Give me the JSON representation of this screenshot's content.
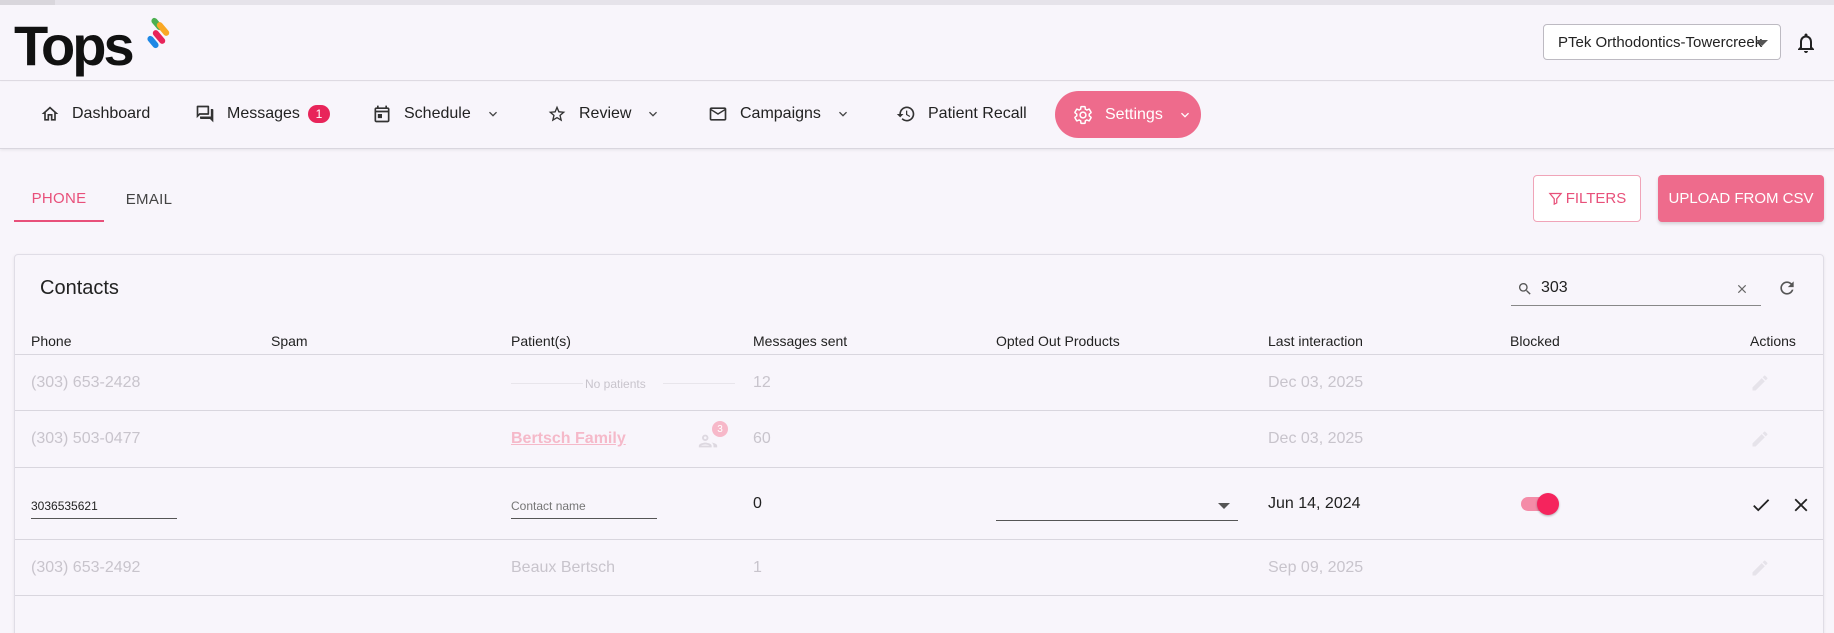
{
  "header": {
    "logo_text": "Tops",
    "org_selector": "PTek Orthodontics-Towercreek"
  },
  "nav": {
    "dashboard": "Dashboard",
    "messages": "Messages",
    "messages_badge": "1",
    "schedule": "Schedule",
    "review": "Review",
    "campaigns": "Campaigns",
    "patient_recall": "Patient Recall",
    "settings": "Settings"
  },
  "tabs": {
    "phone": "PHONE",
    "email": "EMAIL"
  },
  "actions": {
    "filters": "FILTERS",
    "upload": "UPLOAD FROM CSV"
  },
  "contacts": {
    "title": "Contacts",
    "search_value": "303",
    "columns": {
      "phone": "Phone",
      "spam": "Spam",
      "patients": "Patient(s)",
      "messages_sent": "Messages sent",
      "opted_out": "Opted Out Products",
      "last_interaction": "Last interaction",
      "blocked": "Blocked",
      "actions": "Actions"
    },
    "rows": [
      {
        "phone": "(303) 653-2428",
        "patients": "No patients",
        "messages_sent": "12",
        "last_interaction": "Dec 03, 2025"
      },
      {
        "phone": "(303) 503-0477",
        "patients": "Bertsch Family",
        "patient_count": "3",
        "messages_sent": "60",
        "last_interaction": "Dec 03, 2025"
      },
      {
        "phone": "3036535621",
        "patients_placeholder": "Contact name",
        "messages_sent": "0",
        "last_interaction": "Jun 14, 2024",
        "blocked": true
      },
      {
        "phone": "(303) 653-2492",
        "patients": "Beaux Bertsch",
        "messages_sent": "1",
        "last_interaction": "Sep 09, 2025"
      }
    ]
  },
  "colors": {
    "accent": "#ee6b8c",
    "accent_text": "#e8507a",
    "badge": "#e8245a",
    "toggle_thumb": "#f5245d"
  },
  "icons": [
    "home-icon",
    "chat-icon",
    "calendar-icon",
    "star-icon",
    "mail-icon",
    "history-icon",
    "gear-icon",
    "bell-icon",
    "filter-icon",
    "search-icon",
    "close-icon",
    "refresh-icon",
    "pencil-icon",
    "check-icon",
    "group-icon"
  ]
}
